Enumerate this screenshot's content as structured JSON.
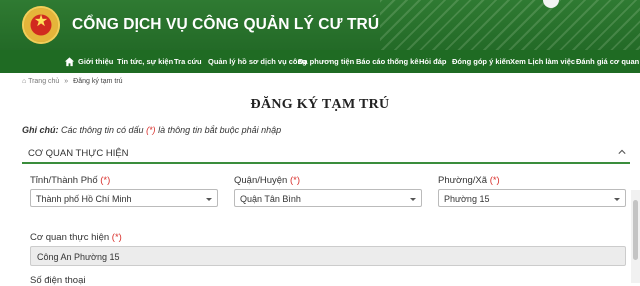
{
  "header": {
    "title": "CỔNG DỊCH VỤ CÔNG QUẢN LÝ CƯ TRÚ",
    "emblem_icon": "police-emblem-icon",
    "brand_color": "#2f7a32"
  },
  "nav": {
    "items": [
      {
        "label": "Giới thiệu"
      },
      {
        "label": "Tin tức, sự kiện"
      },
      {
        "label": "Tra cứu"
      },
      {
        "label": "Quản lý hồ sơ dịch vụ công"
      },
      {
        "label": "Đa phương tiện"
      },
      {
        "label": "Báo cáo thống kê"
      },
      {
        "label": "Hỏi đáp"
      },
      {
        "label": "Đóng góp ý kiến"
      },
      {
        "label": "Xem Lịch làm việc"
      },
      {
        "label": "Đánh giá cơ quan"
      }
    ]
  },
  "breadcrumb": {
    "home": "Trang chủ",
    "separator": "»",
    "current": "Đăng ký tạm trú"
  },
  "page": {
    "title": "ĐĂNG KÝ TẠM TRÚ"
  },
  "note": {
    "prefix": "Ghi chú:",
    "text_before": " Các thông tin có dấu ",
    "marker": "(*)",
    "text_after": " là thông tin bắt buộc phải nhập"
  },
  "section": {
    "title": "CƠ QUAN THỰC HIỆN"
  },
  "form": {
    "required_marker": "(*)",
    "province": {
      "label": "Tỉnh/Thành Phố",
      "value": "Thành phố Hồ Chí Minh"
    },
    "district": {
      "label": "Quận/Huyện",
      "value": "Quận Tân Bình"
    },
    "ward": {
      "label": "Phường/Xã",
      "value": "Phường 15"
    },
    "agency": {
      "label": "Cơ quan thực hiện",
      "value": "Công An Phường 15"
    },
    "phone": {
      "label": "Số điện thoại"
    }
  }
}
